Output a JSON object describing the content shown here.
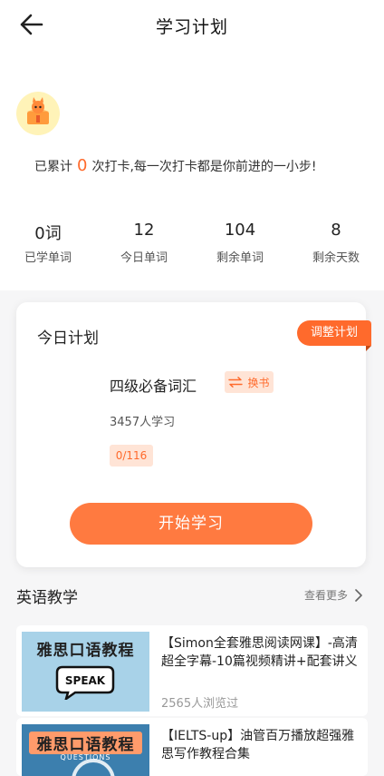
{
  "page": {
    "title": "学习计划"
  },
  "icons": {
    "back": "back-arrow-icon",
    "avatar": "cat-book-icon",
    "swap": "swap-icon",
    "chevron": "chevron-right-icon"
  },
  "colors": {
    "accent": "#ff6a2c",
    "accent_light": "#ffe4d6"
  },
  "streak": {
    "prefix": "已累计",
    "count": "0",
    "suffix": "次打卡,每一次打卡都是你前进的一小步!"
  },
  "stats": [
    {
      "value": "0词",
      "label": "已学单词"
    },
    {
      "value": "12",
      "label": "今日单词"
    },
    {
      "value": "104",
      "label": "剩余单词"
    },
    {
      "value": "8",
      "label": "剩余天数"
    }
  ],
  "plan": {
    "title": "今日计划",
    "adjust_label": "调整计划",
    "book_name": "四级必备词汇",
    "swap_label": "换书",
    "learners": "3457人学习",
    "progress": "0/116",
    "start_label": "开始学习"
  },
  "section": {
    "title": "英语教学",
    "more_label": "查看更多"
  },
  "courses": [
    {
      "thumb_title": "雅思口语教程",
      "thumb_badge": "SPEAK",
      "title": "【Simon全套雅思阅读网课】-高清超全字幕-10篇视频精讲+配套讲义",
      "meta": "2565人浏览过"
    },
    {
      "thumb_title": "雅思口语教程",
      "thumb_badge": "QUESTIONS",
      "title": "【IELTS-up】油管百万播放超强雅思写作教程合集",
      "meta": ""
    }
  ]
}
